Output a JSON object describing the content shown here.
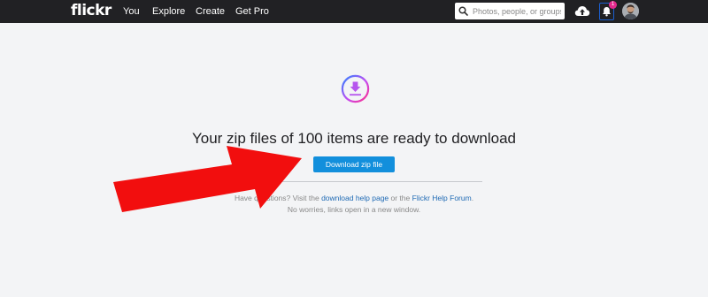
{
  "header": {
    "logo": "flickr",
    "nav": [
      "You",
      "Explore",
      "Create",
      "Get Pro"
    ],
    "search_placeholder": "Photos, people, or groups",
    "notification_count": "1"
  },
  "main": {
    "headline": "Your zip files of 100 items are ready to download",
    "download_button": "Download zip file",
    "help_prefix": "Have questions? Visit the ",
    "help_link_1": "download help page",
    "help_middle": " or the ",
    "help_link_2": "Flickr Help Forum",
    "help_suffix": ".",
    "help_line_2": "No worries, links open in a new window."
  },
  "colors": {
    "topbar": "#212124",
    "button": "#128fdc",
    "link": "#1f6ab4",
    "arrow": "#f20e0e",
    "icon_gradient": [
      "#2d83ff",
      "#c44cf2",
      "#ff2d88"
    ]
  }
}
